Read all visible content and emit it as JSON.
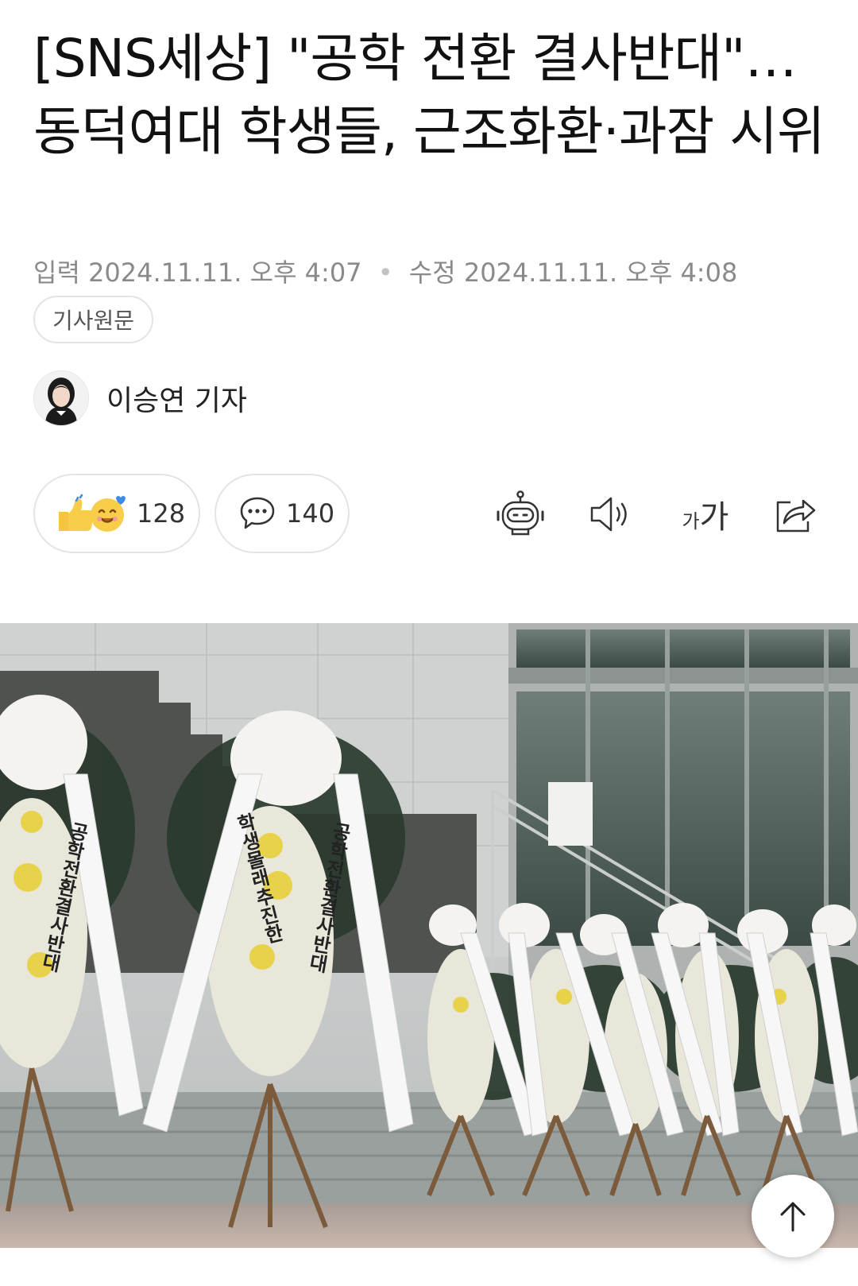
{
  "article": {
    "title": "[SNS세상] \"공학 전환 결사반대\"… 동덕여대 학생들, 근조화환·과잠 시위",
    "input_label": "입력",
    "input_time": "2024.11.11. 오후 4:07",
    "edit_label": "수정",
    "edit_time": "2024.11.11. 오후 4:08",
    "original_button": "기사원문"
  },
  "author": {
    "name": "이승연 기자"
  },
  "actions": {
    "reaction_count": "128",
    "comment_count": "140",
    "font_size_small": "가",
    "font_size_large": "가"
  },
  "icons": {
    "reactions": "thumbs-up-emoji and smiling-face-emoji",
    "comment": "speech-bubble-icon",
    "summary_bot": "robot-icon",
    "tts": "speaker-icon",
    "font_size": "font-size-icon",
    "share": "share-icon",
    "scroll_top": "arrow-up-icon"
  },
  "photo": {
    "subject": "funeral wreaths with ribbons in front of a building",
    "ribbon_text_left": "공학전환결사반대",
    "ribbon_text_center_left": "학생몰래추진한",
    "ribbon_text_center_right": "공학전환결사반대"
  },
  "colors": {
    "text": "#111111",
    "meta": "#8a8a8a",
    "border": "#e4e4e4"
  }
}
